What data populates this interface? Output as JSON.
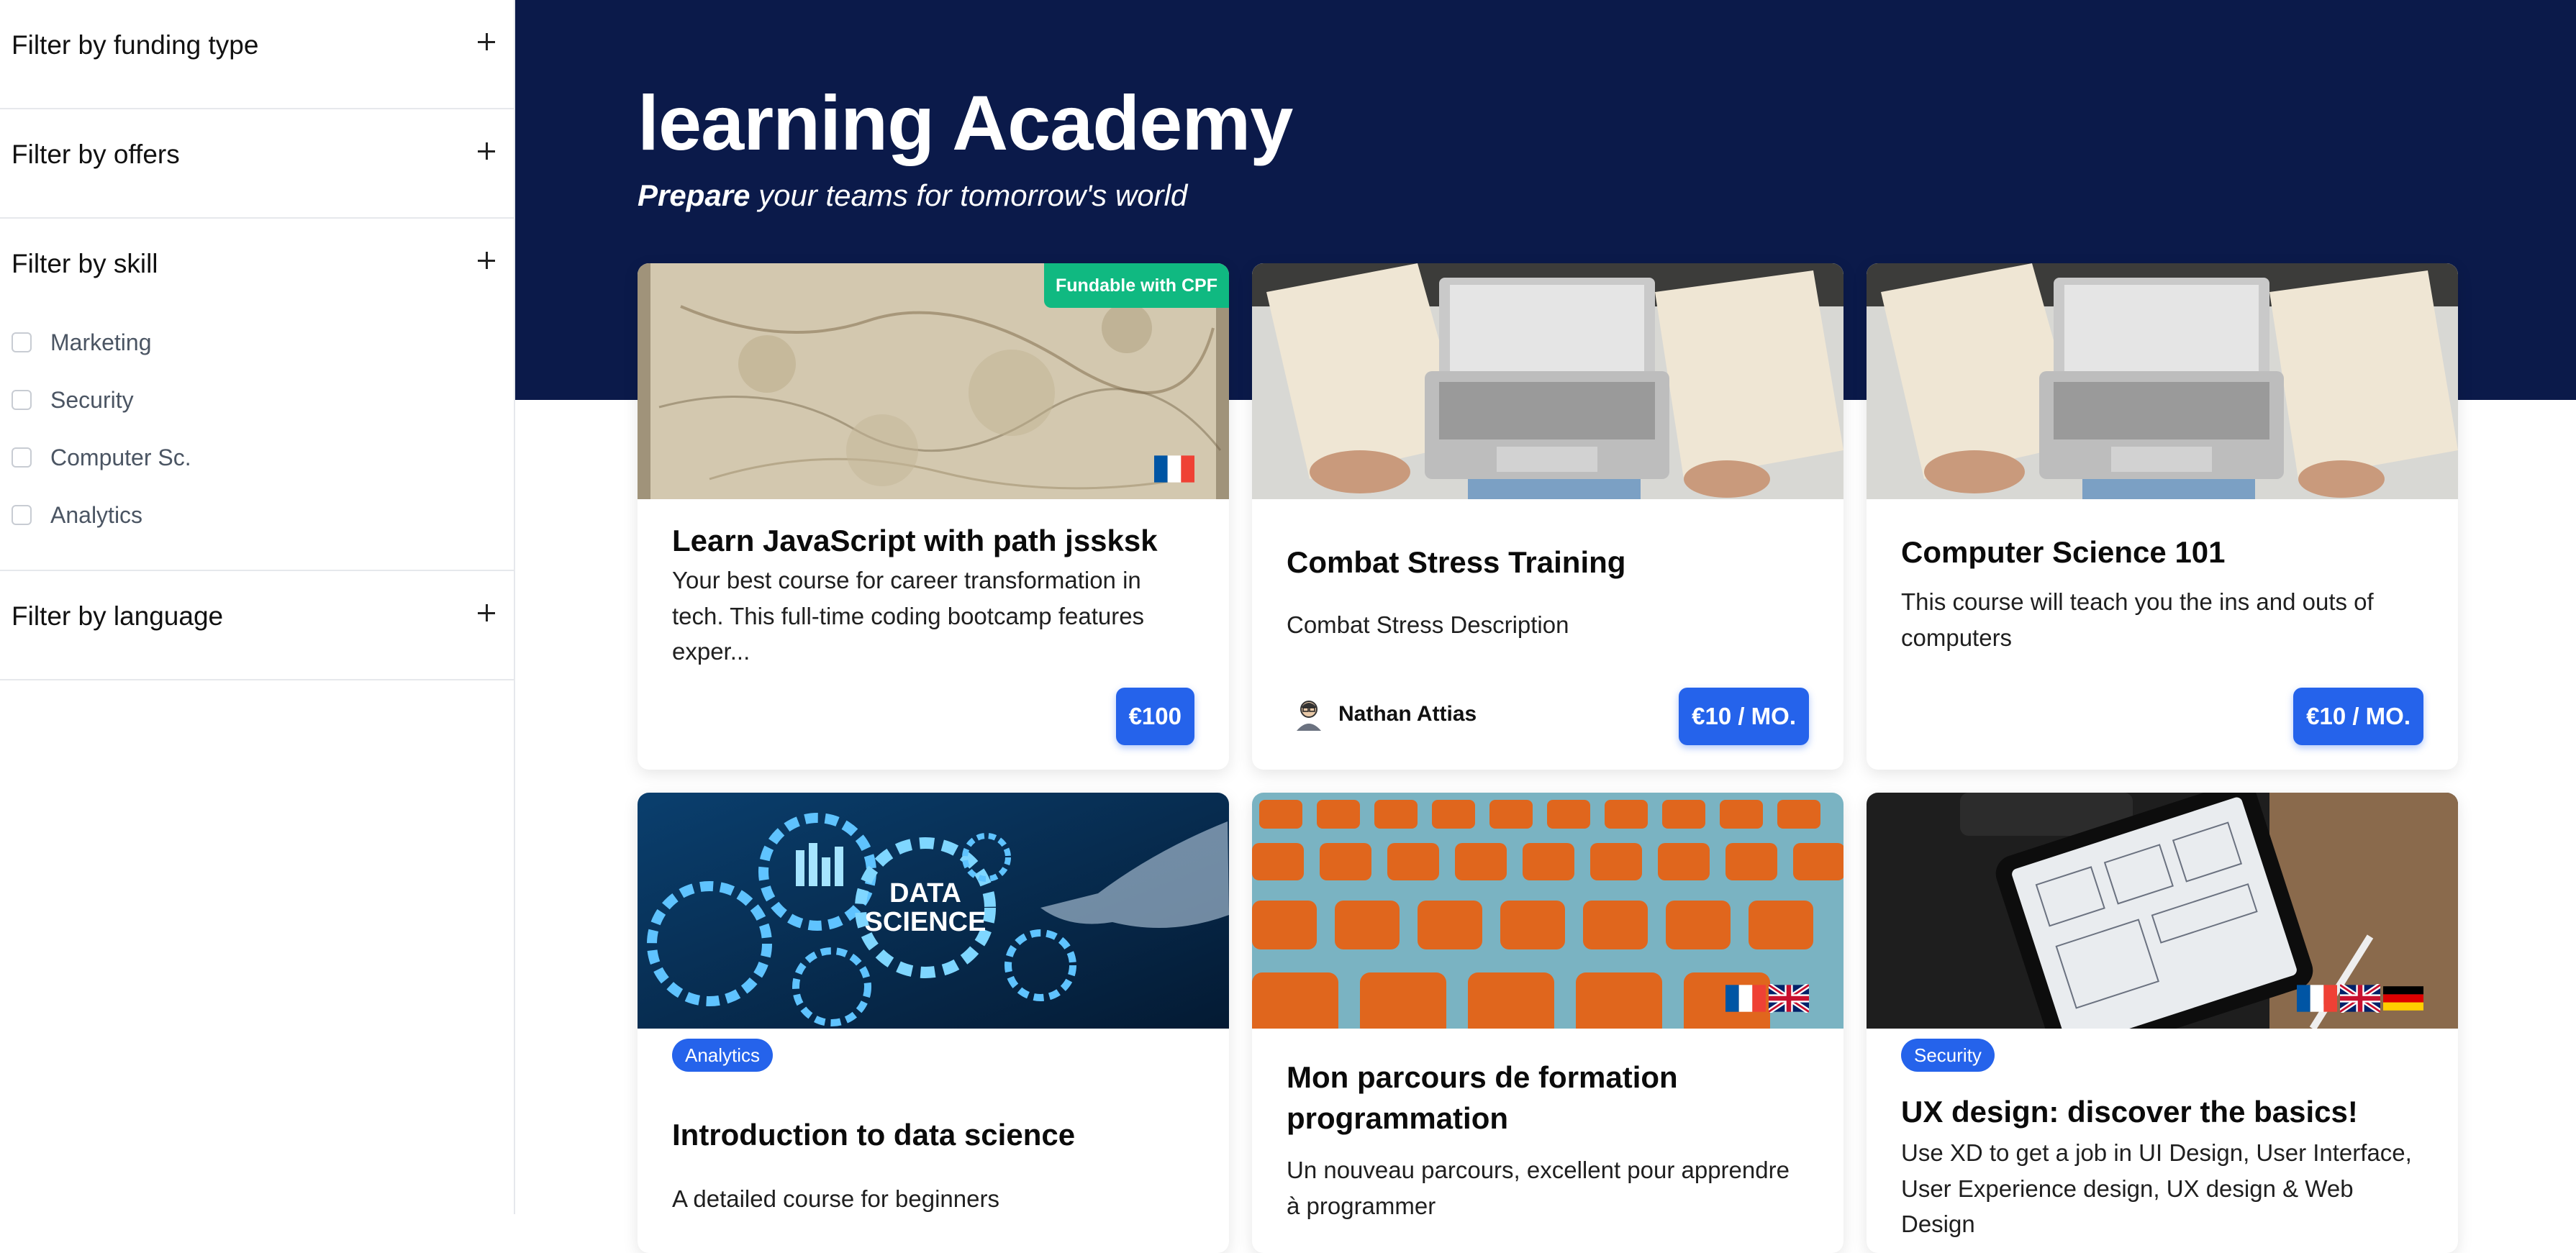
{
  "sidebar": {
    "filters": {
      "funding": "Filter by funding type",
      "offers": "Filter by offers",
      "skill": "Filter by skill",
      "language": "Filter by language"
    },
    "skills": [
      "Marketing",
      "Security",
      "Computer Sc.",
      "Analytics"
    ]
  },
  "hero": {
    "title": "learning Academy",
    "subtitle_bold": "Prepare",
    "subtitle_rest": " your teams for tomorrow's world"
  },
  "cards": [
    {
      "title": "Learn JavaScript with path jssksk",
      "description": "Your best course for career transformation in tech. This full-time coding bootcamp features exper...",
      "price": "€100",
      "badge": "Fundable with CPF",
      "flags": [
        "fr-flag-icon"
      ]
    },
    {
      "title": "Combat Stress Training",
      "description": "Combat Stress Description",
      "price": "€10 / MO.",
      "author": "Nathan Attias"
    },
    {
      "title": "Computer Science 101",
      "description": "This course will teach you the ins and outs of computers",
      "price": "€10 / MO."
    },
    {
      "tag": "Analytics",
      "title": "Introduction to data science",
      "description": "A detailed course for beginners",
      "image_text": [
        "DATA",
        "SCIENCE"
      ]
    },
    {
      "title": "Mon parcours de formation programmation",
      "description": "Un nouveau parcours, excellent pour apprendre à programmer",
      "flags": [
        "fr-flag-icon",
        "uk-flag-icon"
      ]
    },
    {
      "tag": "Security",
      "title": "UX design: discover the basics!",
      "description": "Use XD to get a job in UI Design, User Interface, User Experience design, UX design & Web Design",
      "flags": [
        "fr-flag-icon",
        "uk-flag-icon",
        "de-flag-icon"
      ]
    }
  ],
  "colors": {
    "hero_bg": "#0b1a4a",
    "primary": "#2563eb",
    "cpf_badge": "#10b981"
  }
}
